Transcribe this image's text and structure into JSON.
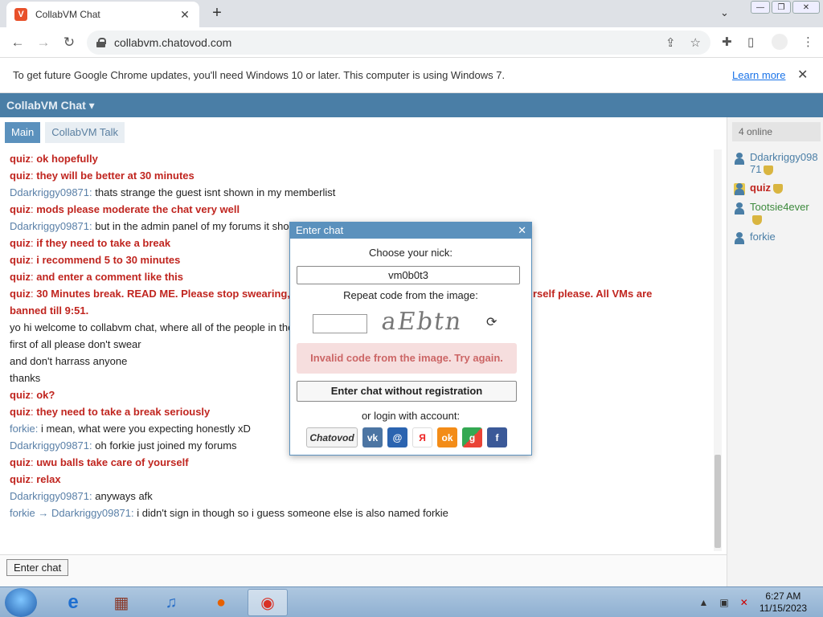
{
  "browser": {
    "tab_title": "CollabVM Chat",
    "tab_close": "✕",
    "new_tab": "+",
    "url": "collabvm.chatovod.com",
    "window_controls": [
      "—",
      "❐",
      "✕"
    ]
  },
  "infobar": {
    "message": "To get future Google Chrome updates, you'll need Windows 10 or later. This computer is using Windows 7.",
    "link": "Learn more",
    "close": "✕"
  },
  "header": {
    "brand": "CollabVM Chat ▾"
  },
  "tabs": [
    {
      "label": "Main",
      "active": true
    },
    {
      "label": "CollabVM Talk",
      "active": false
    }
  ],
  "messages": [
    {
      "nick": "quiz",
      "type": "quiz",
      "text": "ok hopefully"
    },
    {
      "nick": "quiz",
      "type": "quiz",
      "text": "they will be better at 30 minutes"
    },
    {
      "nick": "Ddarkriggy09871",
      "type": "guest",
      "text": "thats strange the guest isnt shown in my memberlist"
    },
    {
      "nick": "quiz",
      "type": "quiz",
      "text": "mods please moderate the chat very well"
    },
    {
      "nick": "Ddarkriggy09871",
      "type": "guest",
      "text": "but in the admin panel of my forums it sho"
    },
    {
      "nick": "quiz",
      "type": "quiz",
      "text": "if they need to take a break"
    },
    {
      "nick": "quiz",
      "type": "quiz",
      "text": "i recommend 5 to 30 minutes"
    },
    {
      "nick": "quiz",
      "type": "quiz",
      "text": "and enter a comment like this"
    },
    {
      "nick": "quiz",
      "type": "quiz",
      "text": "30 Minutes break. READ ME. Please stop swearing,",
      "text_tail": "rself please. All VMs are",
      "text2": "banned till 9:51."
    },
    {
      "nick": "",
      "type": "plain",
      "text": "yo hi welcome to collabvm chat, where all of the people in the"
    },
    {
      "nick": "",
      "type": "plain",
      "text": "first of all please don't swear"
    },
    {
      "nick": "",
      "type": "plain",
      "text": "and don't harrass anyone"
    },
    {
      "nick": "",
      "type": "plain",
      "text": "thanks"
    },
    {
      "nick": "quiz",
      "type": "quiz",
      "text": "ok?"
    },
    {
      "nick": "quiz",
      "type": "quiz",
      "text": "they need to take a break seriously"
    },
    {
      "nick": "forkie",
      "type": "guest",
      "text": "i mean, what were you expecting honestly xD"
    },
    {
      "nick": "Ddarkriggy09871",
      "type": "guest",
      "text": "oh forkie just joined my forums"
    },
    {
      "nick": "quiz",
      "type": "quiz",
      "text": "uwu balls take care of yourself"
    },
    {
      "nick": "quiz",
      "type": "quiz",
      "text": "relax"
    },
    {
      "nick": "Ddarkriggy09871",
      "type": "guest",
      "text": "anyways afk"
    },
    {
      "nick": "forkie → Ddarkriggy09871",
      "type": "guest",
      "text": "i didn't sign in though so i guess someone else is also named forkie"
    }
  ],
  "footer": {
    "enter_chat": "Enter chat"
  },
  "sidebar": {
    "online": "4 online",
    "users": [
      {
        "name": "Ddarkriggy09871",
        "type": "guest",
        "badge": true
      },
      {
        "name": "quiz",
        "type": "quiz",
        "badge": true
      },
      {
        "name": "Tootsie4ever",
        "type": "tootsie",
        "badge": true
      },
      {
        "name": "forkie",
        "type": "guest",
        "badge": false
      }
    ]
  },
  "modal": {
    "title": "Enter chat",
    "close": "✕",
    "nick_label": "Choose your nick:",
    "nick_value": "vm0b0t3",
    "code_label": "Repeat code from the image:",
    "code_value": "",
    "captcha_text": "aEbtn",
    "refresh": "⟳",
    "error": "Invalid code from the image. Try again.",
    "enter_without": "Enter chat without registration",
    "or_login": "or login with account:",
    "socials": [
      "Chatovod",
      "vk",
      "@",
      "Я",
      "ok",
      "g",
      "f"
    ]
  },
  "taskbar": {
    "time": "6:27 AM",
    "date": "11/15/2023"
  }
}
